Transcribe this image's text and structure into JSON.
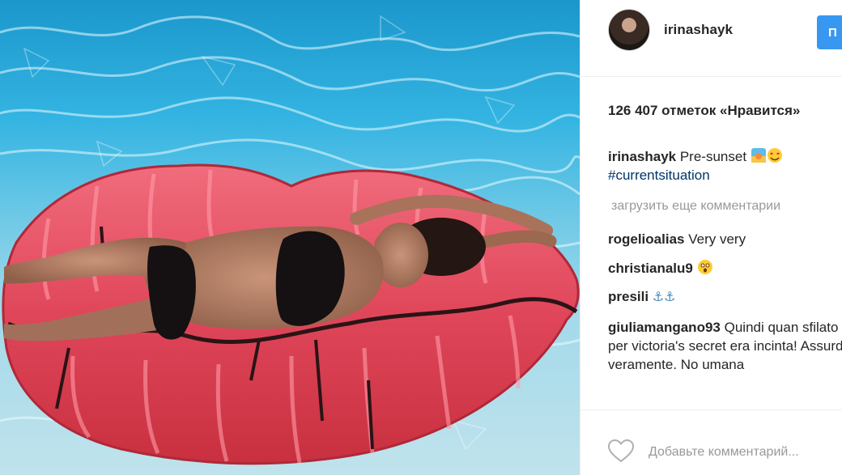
{
  "post": {
    "username": "irinashayk",
    "follow_label": "П",
    "likes_text": "126 407 отметок «Нравится»",
    "caption": {
      "author": "irinashayk",
      "text": "Pre-sunset",
      "hashtag": "#currentsituation"
    },
    "load_more_label": "загрузить еще комментарии",
    "comments": [
      {
        "author": "rogelioalias",
        "text": "Very very"
      },
      {
        "author": "christianalu9",
        "text": ""
      },
      {
        "author": "presili",
        "text": ""
      },
      {
        "author": "giuliamangano93",
        "text": "Quindi quan sfilato per victoria's secret era incinta! Assurdo veramente. No umana"
      }
    ],
    "comment_placeholder": "Добавьте комментарий..."
  },
  "icons": {
    "like": "heart-outline-icon",
    "caption_emojis": [
      "sunset-emoji-icon",
      "heart-eyes-emoji-icon"
    ],
    "christianalu9_emoji": "astonished-emoji-icon",
    "presili_emojis": [
      "anchor-emoji-icon",
      "anchor-emoji-icon"
    ]
  },
  "colors": {
    "follow_button": "#3897f0",
    "hashtag": "#003569",
    "muted_text": "#999999",
    "float_red": "#e0465a"
  }
}
